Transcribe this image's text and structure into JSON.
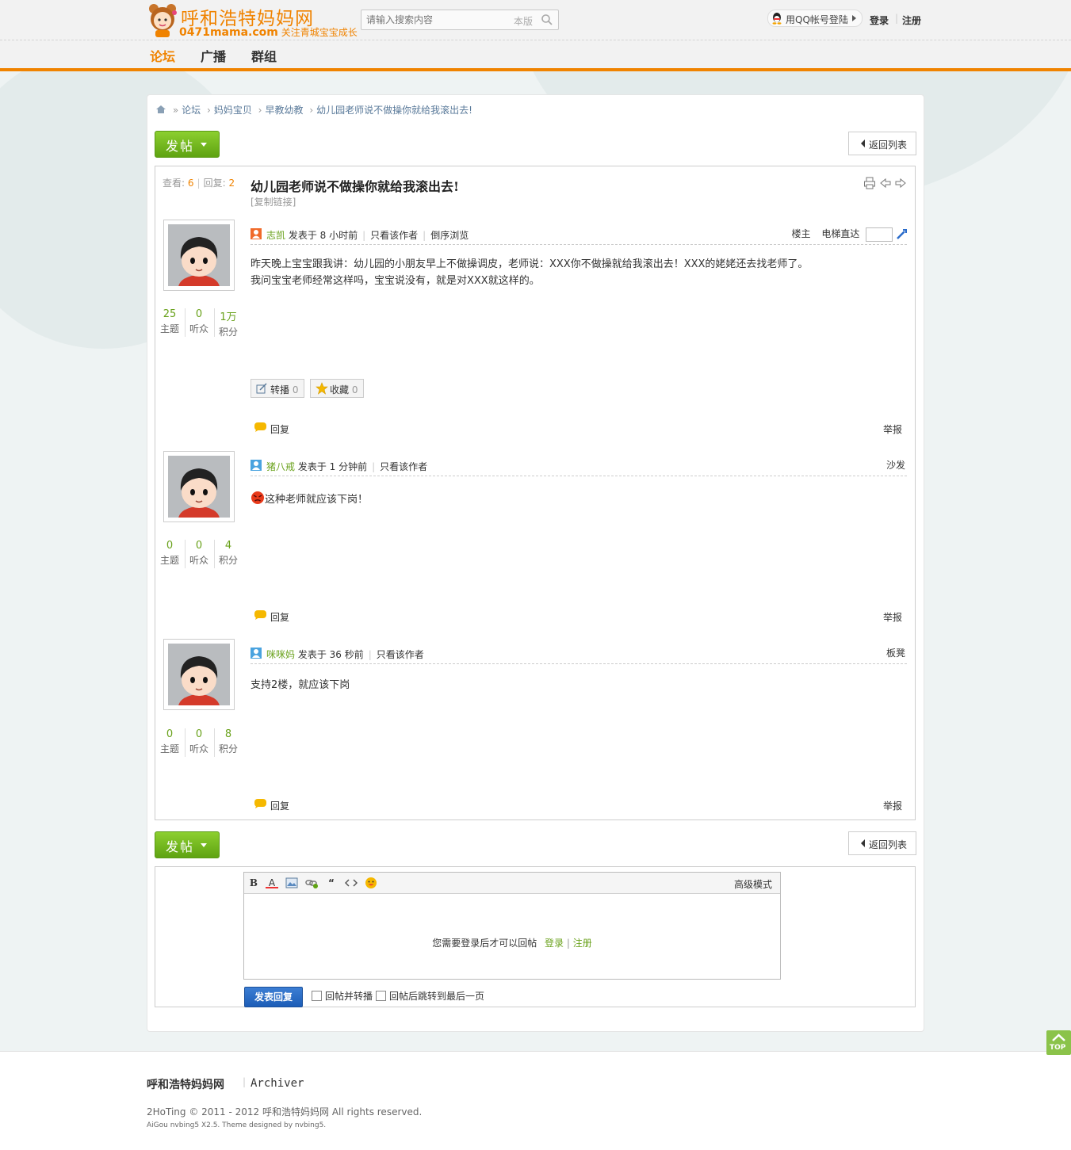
{
  "header": {
    "logo_title": "呼和浩特妈妈网",
    "logo_domain": "0471mama.com",
    "logo_slogan": "关注青城宝宝成长",
    "search_placeholder": "请输入搜索内容",
    "search_scope": "本版",
    "qq_login": "用QQ帐号登陆",
    "login": "登录",
    "register": "注册",
    "nav": [
      "论坛",
      "广播",
      "群组"
    ]
  },
  "breadcrumb": [
    "论坛",
    "妈妈宝贝",
    "早教幼教",
    "幼儿园老师说不做操你就给我滚出去!"
  ],
  "toolbar": {
    "post": "发帖",
    "back": "返回列表"
  },
  "thread": {
    "views_label": "查看:",
    "views": "6",
    "replies_label": "回复:",
    "replies": "2",
    "title": "幼儿园老师说不做操你就给我滚出去!",
    "copy_link": "[复制链接]",
    "elevator_label": "电梯直达"
  },
  "posts": [
    {
      "author": "志凯",
      "time": "发表于 8 小时前",
      "only_author": "只看该作者",
      "reverse": "倒序浏览",
      "floor": "楼主",
      "lines": [
        "昨天晚上宝宝跟我讲：幼儿园的小朋友早上不做操调皮，老师说：XXX你不做操就给我滚出去！XXX的姥姥还去找老师了。",
        "我问宝宝老师经常这样吗，宝宝说没有，就是对XXX就这样的。"
      ],
      "stats": [
        {
          "v": "25",
          "l": "主题"
        },
        {
          "v": "0",
          "l": "听众"
        },
        {
          "v": "1万",
          "l": "积分"
        }
      ],
      "share": "转播",
      "share_count": "0",
      "fav": "收藏",
      "fav_count": "0",
      "reply": "回复",
      "report": "举报"
    },
    {
      "author": "猪八戒",
      "time": "发表于 1 分钟前",
      "only_author": "只看该作者",
      "floor": "沙发",
      "lines": [
        "这种老师就应该下岗！"
      ],
      "stats": [
        {
          "v": "0",
          "l": "主题"
        },
        {
          "v": "0",
          "l": "听众"
        },
        {
          "v": "4",
          "l": "积分"
        }
      ],
      "reply": "回复",
      "report": "举报"
    },
    {
      "author": "咪咪妈",
      "time": "发表于 36 秒前",
      "only_author": "只看该作者",
      "floor": "板凳",
      "lines": [
        "支持2楼，就应该下岗"
      ],
      "stats": [
        {
          "v": "0",
          "l": "主题"
        },
        {
          "v": "0",
          "l": "听众"
        },
        {
          "v": "8",
          "l": "积分"
        }
      ],
      "reply": "回复",
      "report": "举报"
    }
  ],
  "editor": {
    "advanced": "高级模式",
    "tools": [
      "B",
      "A"
    ],
    "notice": "您需要登录后才可以回帖",
    "login": "登录",
    "register": "注册",
    "submit": "发表回复",
    "opt_share": "回帖并转播",
    "opt_jump": "回帖后跳转到最后一页"
  },
  "footer": {
    "site": "呼和浩特妈妈网",
    "archiver": "Archiver",
    "copyright": "2HoTing © 2011 - 2012 呼和浩特妈妈网 All rights reserved.",
    "powered": "AiGou nvbing5 X2.5. Theme designed by nvbing5."
  },
  "top_button": "TOP",
  "colors": {
    "accent": "#f08300",
    "green": "#6aa21c",
    "post_button": "#6fb51c",
    "submit_button": "#2a6ccb"
  }
}
